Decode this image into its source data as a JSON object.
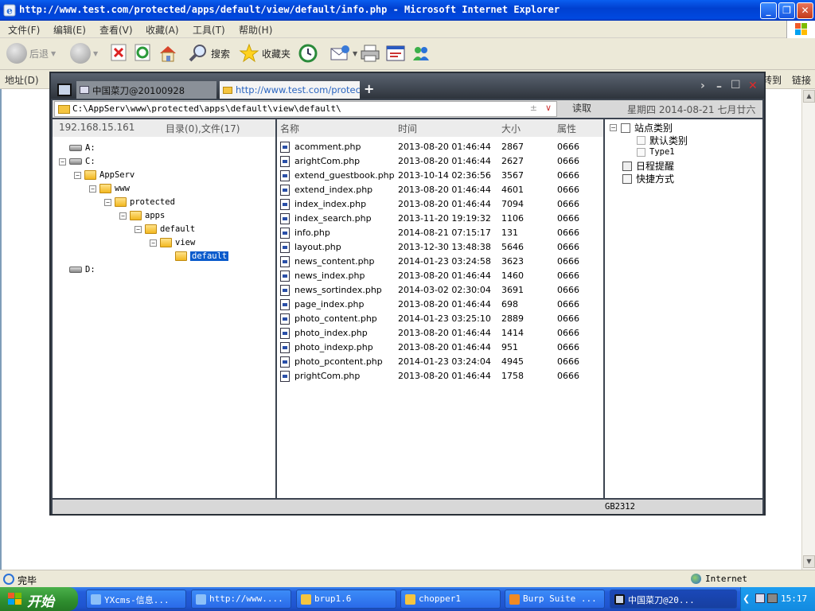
{
  "window": {
    "title": "http://www.test.com/protected/apps/default/view/default/info.php - Microsoft Internet Explorer",
    "minimize": "_",
    "restore": "❐",
    "close": "✕"
  },
  "menu": [
    "文件(F)",
    "编辑(E)",
    "查看(V)",
    "收藏(A)",
    "工具(T)",
    "帮助(H)"
  ],
  "toolbar": {
    "back": "后退",
    "search": "搜索",
    "favorites": "收藏夹"
  },
  "address": {
    "label": "地址(D)",
    "go": "转到",
    "links": "链接"
  },
  "chopper": {
    "tabs": [
      {
        "label": "中国菜刀@20100928"
      },
      {
        "label": "http://www.test.com/protecte..."
      }
    ],
    "new_tab": "+",
    "path": "C:\\AppServ\\www\\protected\\apps\\default\\view\\default\\",
    "path_plusminus": "±",
    "path_dropdown": "∨",
    "read_button": "读取",
    "date": "星期四 2014-08-21 七月廿六",
    "ip": "192.168.15.161",
    "dir_count": "目录(0),文件(17)",
    "tree": [
      {
        "label": "A:",
        "type": "drive",
        "expander": "",
        "selected": false
      },
      {
        "label": "C:",
        "type": "drive",
        "expander": "−",
        "selected": false
      },
      {
        "label": "AppServ",
        "type": "folder",
        "expander": "−",
        "selected": false
      },
      {
        "label": "www",
        "type": "folder",
        "expander": "−",
        "selected": false
      },
      {
        "label": "protected",
        "type": "folder",
        "expander": "−",
        "selected": false
      },
      {
        "label": "apps",
        "type": "folder",
        "expander": "−",
        "selected": false
      },
      {
        "label": "default",
        "type": "folder",
        "expander": "−",
        "selected": false
      },
      {
        "label": "view",
        "type": "folder",
        "expander": "−",
        "selected": false
      },
      {
        "label": "default",
        "type": "folder",
        "expander": "",
        "selected": true
      },
      {
        "label": "D:",
        "type": "drive",
        "expander": "",
        "selected": false
      }
    ],
    "columns": {
      "name": "名称",
      "time": "时间",
      "size": "大小",
      "attr": "属性"
    },
    "files": [
      {
        "name": "acomment.php",
        "time": "2013-08-20 01:46:44",
        "size": "2867",
        "attr": "0666"
      },
      {
        "name": "arightCom.php",
        "time": "2013-08-20 01:46:44",
        "size": "2627",
        "attr": "0666"
      },
      {
        "name": "extend_guestbook.php",
        "time": "2013-10-14 02:36:56",
        "size": "3567",
        "attr": "0666"
      },
      {
        "name": "extend_index.php",
        "time": "2013-08-20 01:46:44",
        "size": "4601",
        "attr": "0666"
      },
      {
        "name": "index_index.php",
        "time": "2013-08-20 01:46:44",
        "size": "7094",
        "attr": "0666"
      },
      {
        "name": "index_search.php",
        "time": "2013-11-20 19:19:32",
        "size": "1106",
        "attr": "0666"
      },
      {
        "name": "info.php",
        "time": "2014-08-21 07:15:17",
        "size": "131",
        "attr": "0666"
      },
      {
        "name": "layout.php",
        "time": "2013-12-30 13:48:38",
        "size": "5646",
        "attr": "0666"
      },
      {
        "name": "news_content.php",
        "time": "2014-01-23 03:24:58",
        "size": "3623",
        "attr": "0666"
      },
      {
        "name": "news_index.php",
        "time": "2013-08-20 01:46:44",
        "size": "1460",
        "attr": "0666"
      },
      {
        "name": "news_sortindex.php",
        "time": "2014-03-02 02:30:04",
        "size": "3691",
        "attr": "0666"
      },
      {
        "name": "page_index.php",
        "time": "2013-08-20 01:46:44",
        "size": "698",
        "attr": "0666"
      },
      {
        "name": "photo_content.php",
        "time": "2014-01-23 03:25:10",
        "size": "2889",
        "attr": "0666"
      },
      {
        "name": "photo_index.php",
        "time": "2013-08-20 01:46:44",
        "size": "1414",
        "attr": "0666"
      },
      {
        "name": "photo_indexp.php",
        "time": "2013-08-20 01:46:44",
        "size": "951",
        "attr": "0666"
      },
      {
        "name": "photo_pcontent.php",
        "time": "2014-01-23 03:24:04",
        "size": "4945",
        "attr": "0666"
      },
      {
        "name": "prightCom.php",
        "time": "2013-08-20 01:46:44",
        "size": "1758",
        "attr": "0666"
      }
    ],
    "right": {
      "site_category": "站点类别",
      "default_category": "默认类别",
      "type1": "Type1",
      "schedule": "日程提醒",
      "shortcuts": "快捷方式"
    },
    "encoding": "GB2312"
  },
  "status": {
    "text": "完毕",
    "zone": "Internet"
  },
  "taskbar": {
    "start": "开始",
    "tasks": [
      {
        "label": "YXcms-信息..."
      },
      {
        "label": "http://www...."
      },
      {
        "label": "brup1.6"
      },
      {
        "label": "chopper1"
      },
      {
        "label": "Burp Suite ..."
      },
      {
        "label": "中国菜刀@20..."
      }
    ],
    "clock": "15:17"
  }
}
